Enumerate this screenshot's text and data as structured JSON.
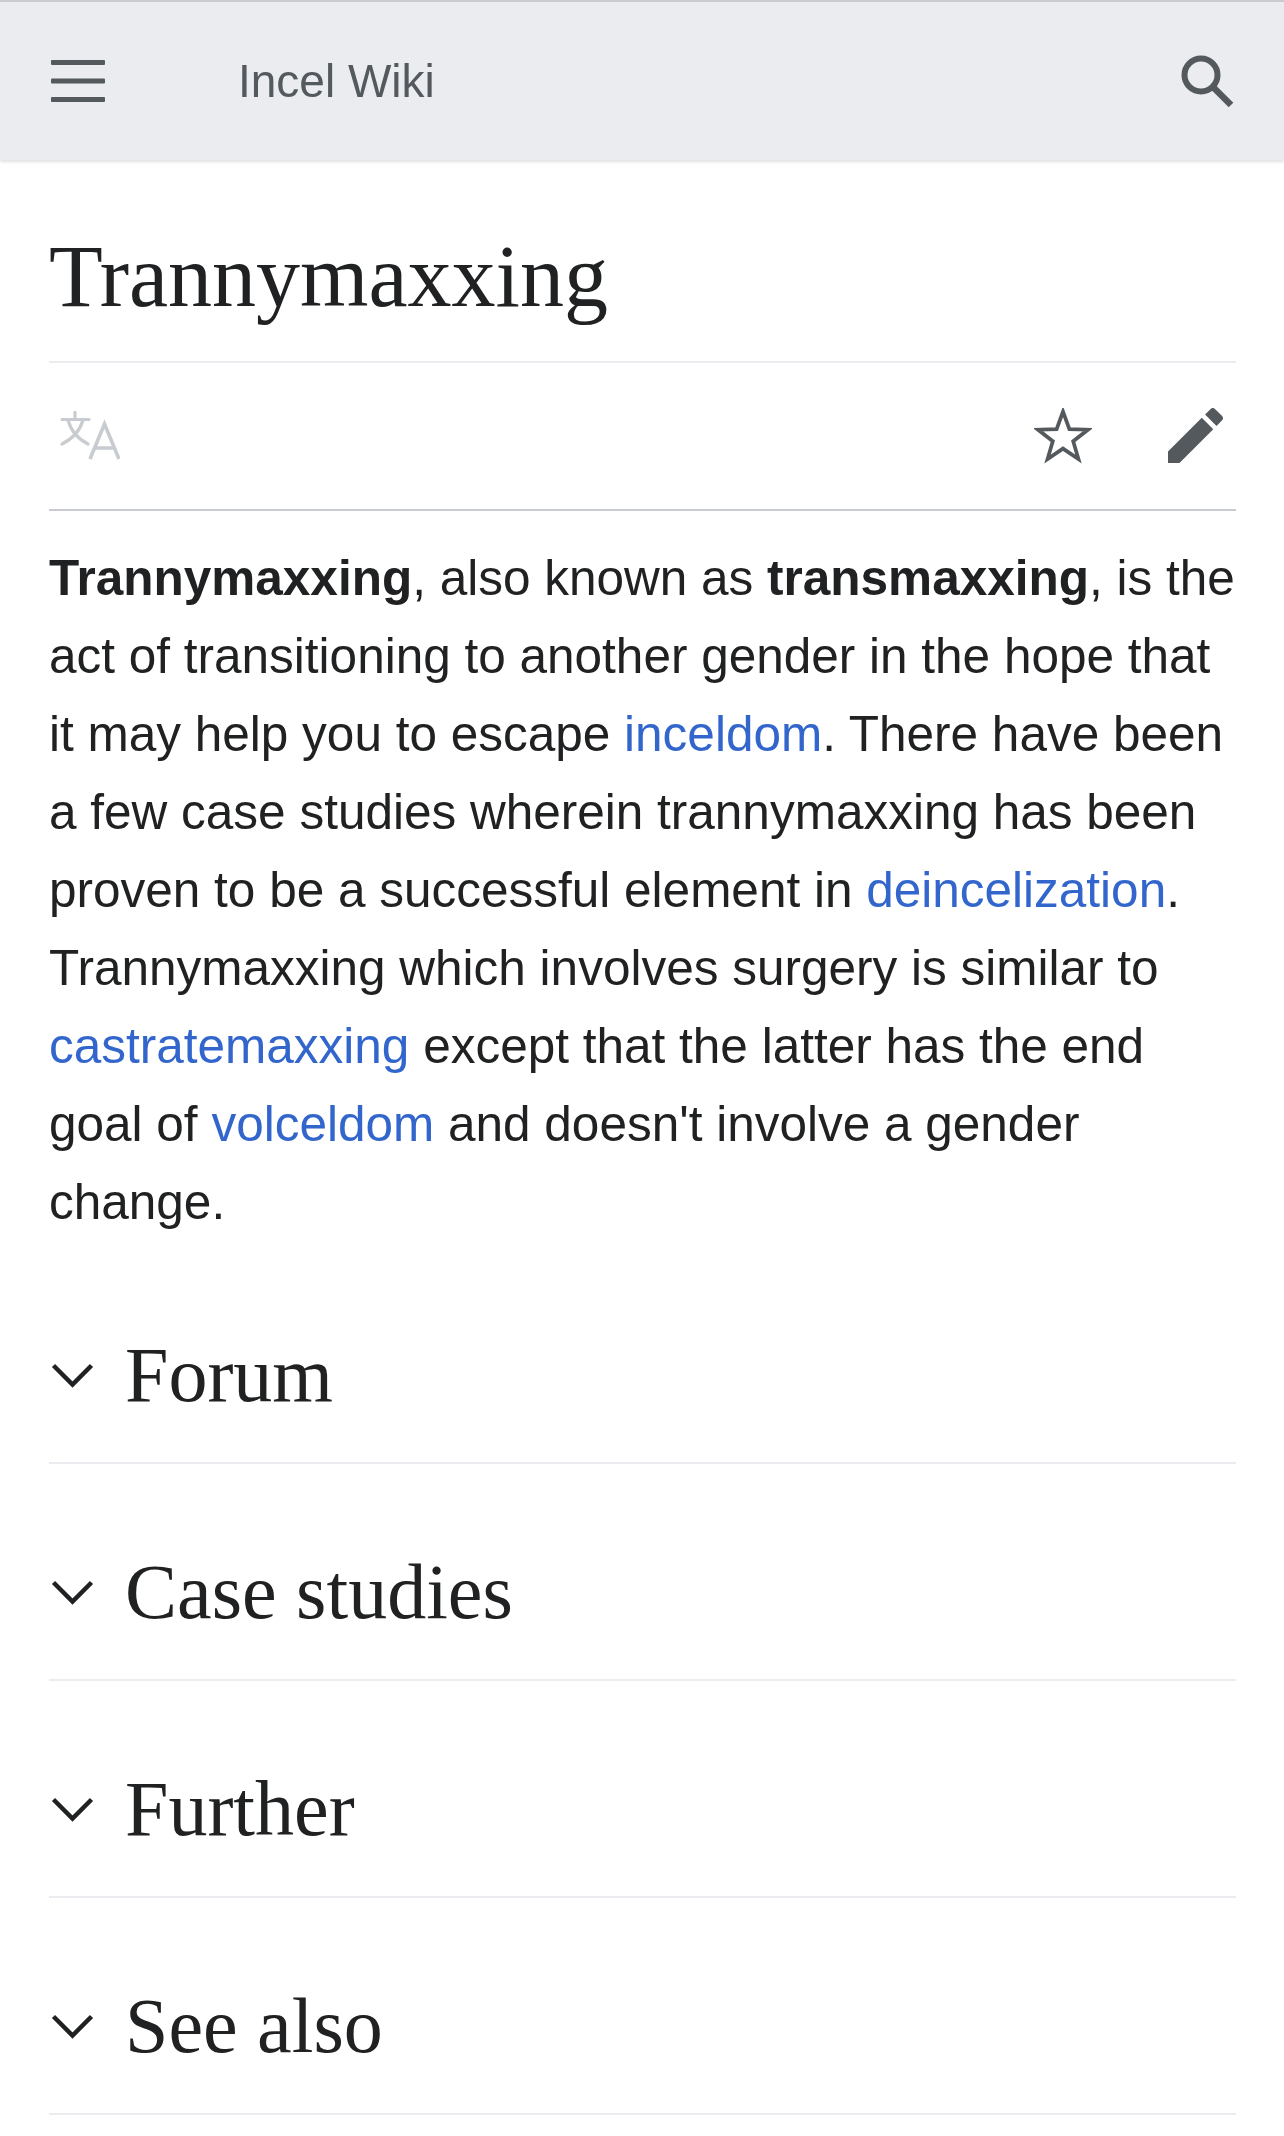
{
  "header": {
    "title": "Incel Wiki"
  },
  "page": {
    "title": "Trannymaxxing"
  },
  "page_actions": {
    "language_disabled": true,
    "watched": false
  },
  "intro": [
    {
      "kind": "text",
      "text": "**Trannymaxxing**, also known as **transmaxxing**, is the act of transitioning to another gender in the hope that it may help you to escape "
    },
    {
      "kind": "link",
      "text": "inceldom"
    },
    {
      "kind": "text",
      "text": ". There have been a few case studies wherein trannymaxxing has been proven to be a successful element in "
    },
    {
      "kind": "link",
      "text": "deincelization"
    },
    {
      "kind": "text",
      "text": ". Trannymaxxing which involves surgery is similar to "
    },
    {
      "kind": "link",
      "text": "castratemaxxing"
    },
    {
      "kind": "text",
      "text": " except that the latter has the end goal of "
    },
    {
      "kind": "link",
      "text": "volceldom"
    },
    {
      "kind": "text",
      "text": " and doesn't involve a gender change."
    }
  ],
  "sections": [
    {
      "title": "Forum",
      "expanded": false
    },
    {
      "title": "Case studies",
      "expanded": false
    },
    {
      "title": "Further",
      "expanded": false
    },
    {
      "title": "See also",
      "expanded": false
    }
  ]
}
